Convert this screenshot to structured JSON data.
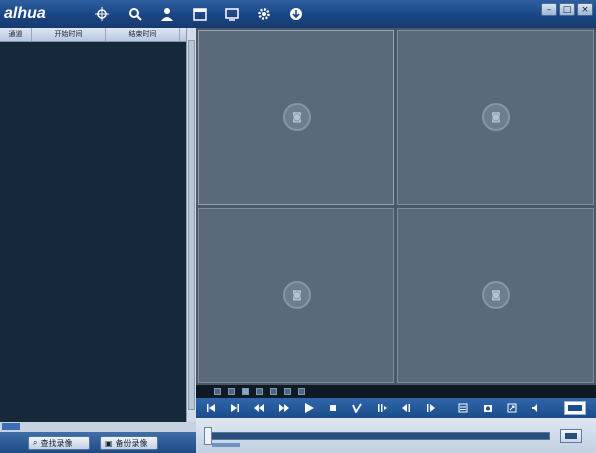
{
  "app": {
    "logo": "alhua"
  },
  "toolbar": {
    "icons": [
      "crosshair-icon",
      "search-icon",
      "user-icon",
      "calendar-icon",
      "display-icon",
      "gear-icon",
      "download-icon"
    ]
  },
  "window": {
    "minimize": "–",
    "restore": "□",
    "close": "×"
  },
  "record_list": {
    "columns": [
      "通道",
      "开始时间",
      "结束时间"
    ]
  },
  "left_buttons": {
    "search_label": "查找录像",
    "backup_label": "备份录像"
  },
  "video_grid": {
    "panes": 4
  },
  "colors": {
    "accent": "#1f4a84",
    "pane": "#5a6a7a",
    "list_bg": "#15293a"
  }
}
